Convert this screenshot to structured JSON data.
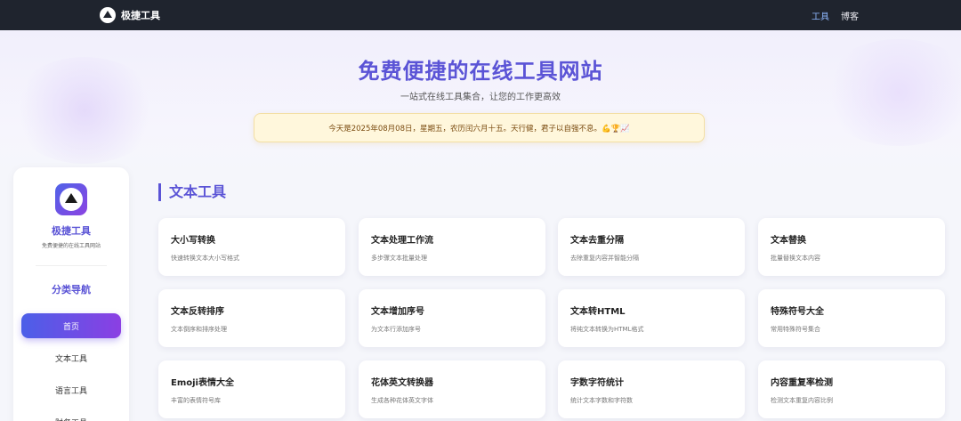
{
  "nav": {
    "brand": "极捷工具",
    "links": [
      {
        "label": "工具",
        "active": true
      },
      {
        "label": "博客",
        "active": false
      }
    ]
  },
  "hero": {
    "title": "免费便捷的在线工具网站",
    "subtitle": "一站式在线工具集合，让您的工作更高效",
    "date_banner": "今天是2025年08月08日，星期五，农历闰六月十五。天行健，君子以自强不息。💪🏆📈"
  },
  "sidebar": {
    "name": "极捷工具",
    "desc": "免费便捷的在线工具网站",
    "heading": "分类导航",
    "items": [
      {
        "label": "首页",
        "active": true
      },
      {
        "label": "文本工具",
        "active": false
      },
      {
        "label": "语言工具",
        "active": false
      },
      {
        "label": "财务工具",
        "active": false
      }
    ]
  },
  "section": {
    "title": "文本工具",
    "cards": [
      {
        "title": "大小写转换",
        "desc": "快速转换文本大小写格式"
      },
      {
        "title": "文本处理工作流",
        "desc": "多步骤文本批量处理"
      },
      {
        "title": "文本去重分隔",
        "desc": "去除重复内容并智能分隔"
      },
      {
        "title": "文本替换",
        "desc": "批量替换文本内容"
      },
      {
        "title": "文本反转排序",
        "desc": "文本倒序和排序处理"
      },
      {
        "title": "文本增加序号",
        "desc": "为文本行添加序号"
      },
      {
        "title": "文本转HTML",
        "desc": "将纯文本转换为HTML格式"
      },
      {
        "title": "特殊符号大全",
        "desc": "常用特殊符号集合"
      },
      {
        "title": "Emoji表情大全",
        "desc": "丰富的表情符号库"
      },
      {
        "title": "花体英文转换器",
        "desc": "生成各种花体英文字体"
      },
      {
        "title": "字数字符统计",
        "desc": "统计文本字数和字符数"
      },
      {
        "title": "内容重复率检测",
        "desc": "检测文本重复内容比例"
      }
    ]
  }
}
